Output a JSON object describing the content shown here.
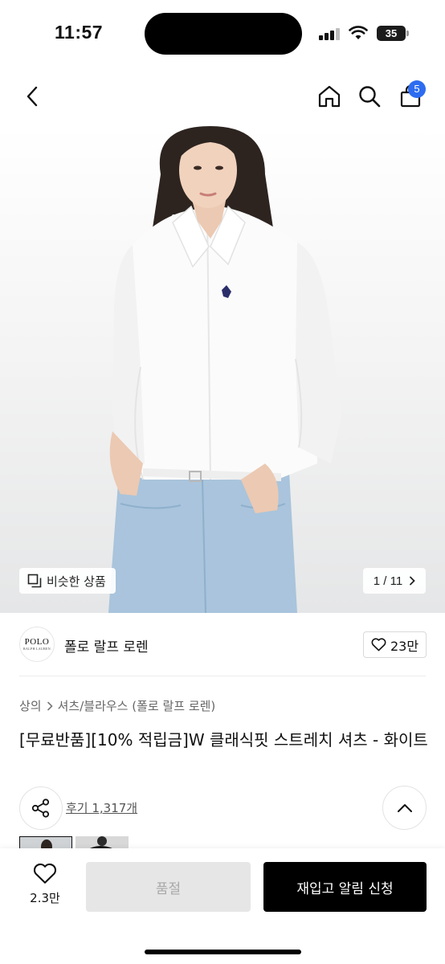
{
  "status_bar": {
    "time": "11:57",
    "battery": "35"
  },
  "nav": {
    "cart_count": "5",
    "icons": [
      "back-icon",
      "home-icon",
      "search-icon",
      "cart-icon"
    ]
  },
  "gallery": {
    "similar_label": "비슷한 상품",
    "pager": "1 / 11"
  },
  "brand": {
    "logo_text": "POLO",
    "logo_subtext": "RALPH LAUREN",
    "name": "폴로 랄프 로렌",
    "like_count": "23만"
  },
  "product": {
    "breadcrumb": [
      "상의",
      "셔츠/블라우스 (폴로 랄프 로렌)"
    ],
    "title": "[무료반품][10% 적립금]W 클래식핏 스트레치 셔츠 - 화이트",
    "review_link": "후기 1,317개"
  },
  "bottom_bar": {
    "wish_count": "2.3만",
    "soldout_label": "품절",
    "restock_label": "재입고 알림 신청"
  },
  "colors": {
    "accent_badge": "#2d6cf0",
    "primary_button": "#000000",
    "disabled_button": "#e6e6e6"
  }
}
